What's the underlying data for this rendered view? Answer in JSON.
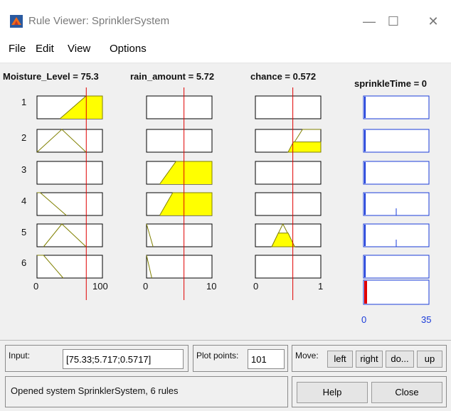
{
  "window": {
    "title": "Rule Viewer: SprinklerSystem",
    "minimize_glyph": "—",
    "maximize_glyph": "☐",
    "close_glyph": "✕"
  },
  "menu": [
    "File",
    "Edit",
    "View",
    "Options"
  ],
  "variables": [
    {
      "title": "Moisture_Level = 75.3",
      "range": [
        0,
        100
      ],
      "value": 75.3,
      "ticks": [
        "0",
        "100"
      ]
    },
    {
      "title": "rain_amount = 5.72",
      "range": [
        0,
        10
      ],
      "value": 5.72,
      "ticks": [
        "0",
        "10"
      ]
    },
    {
      "title": "chance = 0.572",
      "range": [
        0,
        1
      ],
      "value": 0.572,
      "ticks": [
        "0",
        "1"
      ]
    },
    {
      "title": "sprinkleTime = 0",
      "range": [
        0,
        35
      ],
      "value": 0,
      "ticks": [
        "0",
        "35"
      ]
    }
  ],
  "rows": [
    "1",
    "2",
    "3",
    "4",
    "5",
    "6"
  ],
  "colors": {
    "fill": "#ffff00",
    "line": "#808000",
    "indicator": "#e00000",
    "output": "#1a3bd9",
    "aggregate": "#e00000"
  },
  "controls": {
    "input_label": "Input:",
    "input_value": "[75.33;5.717;0.5717]",
    "plot_points_label": "Plot points:",
    "plot_points_value": "101",
    "move_label": "Move:",
    "left_label": "left",
    "right_label": "right",
    "down_label": "do...",
    "up_label": "up",
    "help_label": "Help",
    "close_label": "Close",
    "status": "Opened system SprinklerSystem, 6 rules"
  }
}
